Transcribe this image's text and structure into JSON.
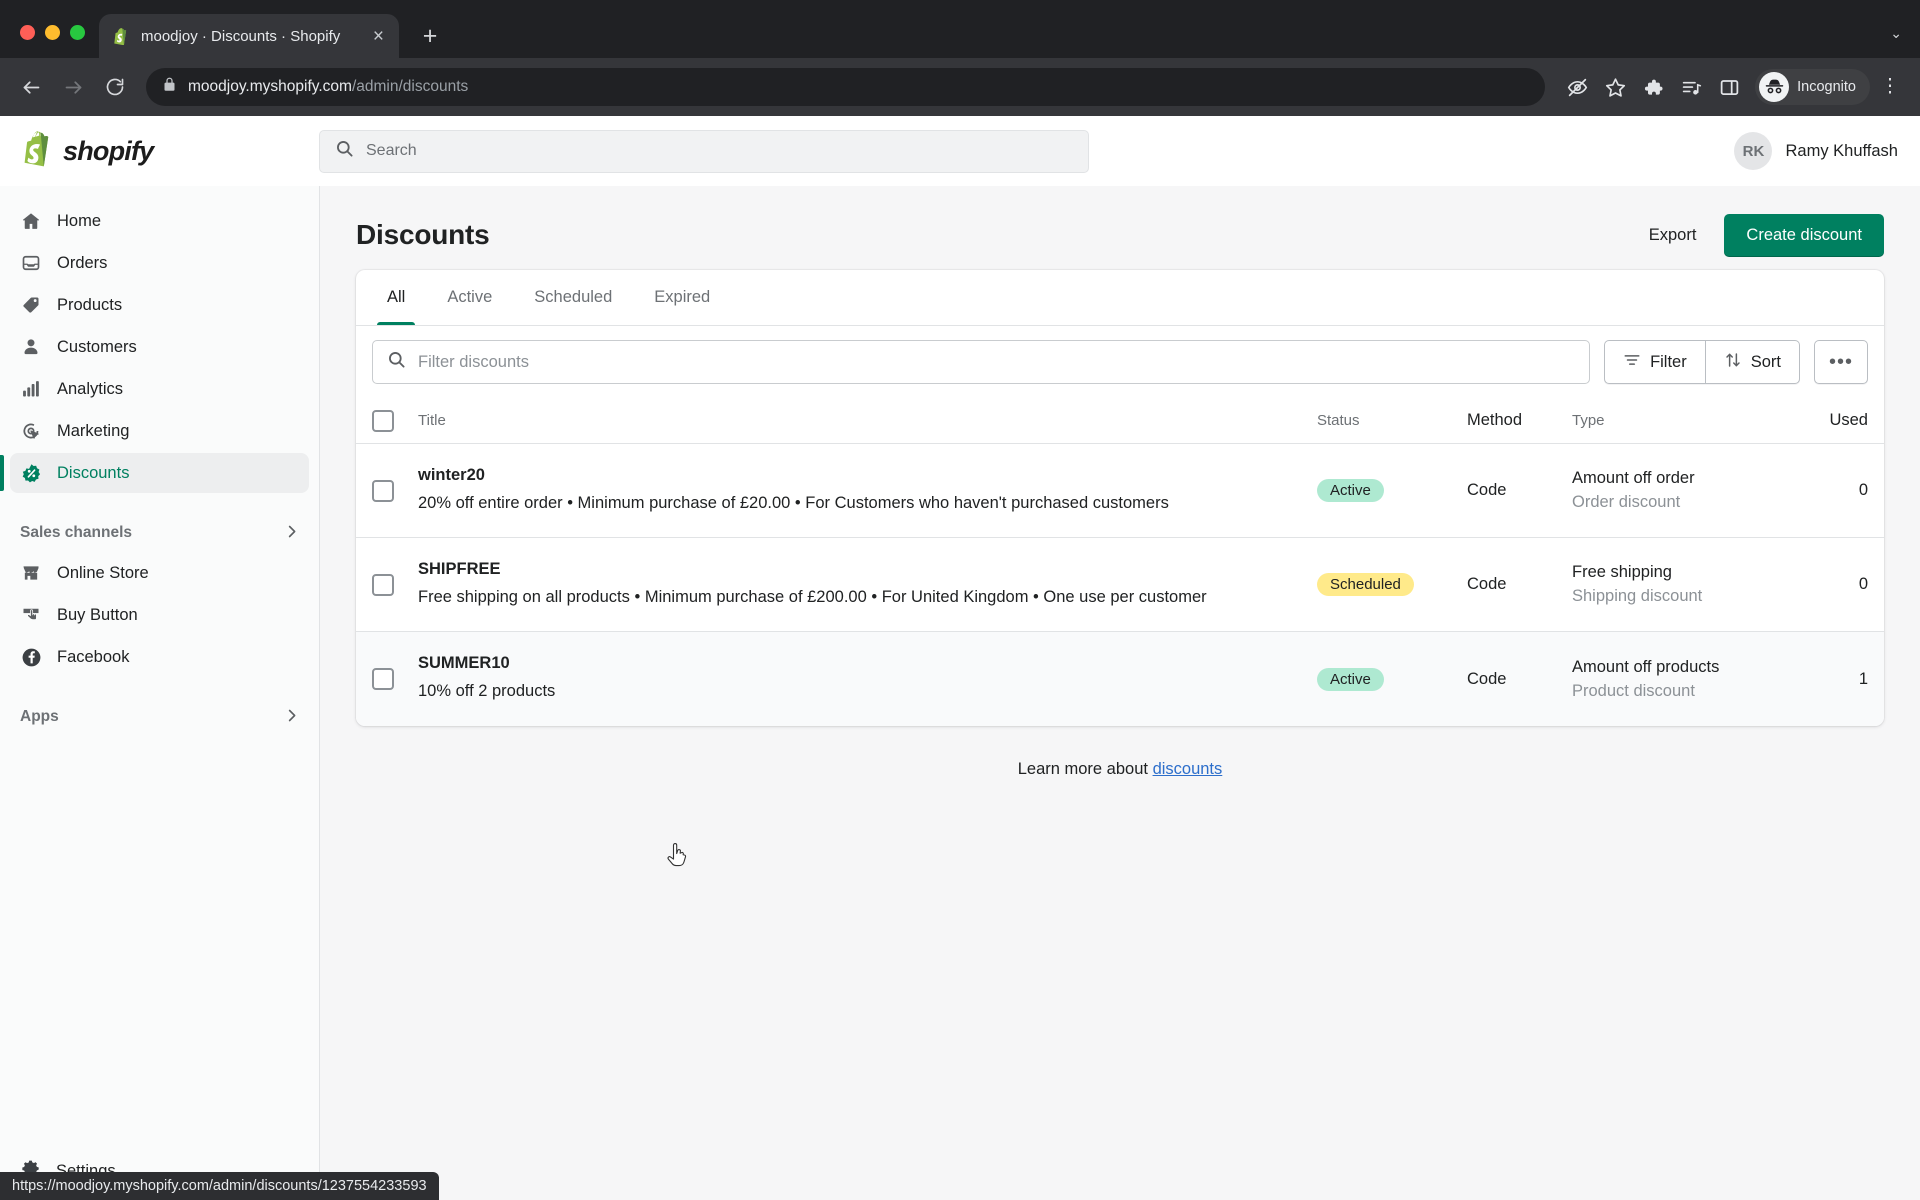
{
  "browser": {
    "tab_title": "moodjoy · Discounts · Shopify",
    "tab_close_label": "×",
    "new_tab_label": "+",
    "url_host": "moodjoy.myshopify.com",
    "url_path": "/admin/discounts",
    "back_label": "←",
    "forward_label": "→",
    "reload_label": "⟳",
    "tab_list_label": "⌄",
    "icons": {
      "eye_off": "eye-off-icon",
      "bookmark": "star-icon",
      "extensions": "puzzle-icon",
      "media": "media-playlist-icon",
      "side_panel": "split-panel-icon",
      "profile": "incognito-avatar-icon",
      "menu": "three-dot-menu-icon"
    },
    "profile_label": "Incognito",
    "kebab_label": "⋮",
    "status_bar_url": "https://moodjoy.myshopify.com/admin/discounts/1237554233593"
  },
  "topbar": {
    "logo_word": "shopify",
    "search_placeholder": "Search",
    "search_value": "",
    "user_initials": "RK",
    "user_name": "Ramy Khuffash"
  },
  "sidebar": {
    "items": [
      {
        "label": "Home",
        "icon": "home-icon"
      },
      {
        "label": "Orders",
        "icon": "orders-inbox-icon"
      },
      {
        "label": "Products",
        "icon": "product-tag-icon"
      },
      {
        "label": "Customers",
        "icon": "customer-person-icon"
      },
      {
        "label": "Analytics",
        "icon": "bar-chart-icon"
      },
      {
        "label": "Marketing",
        "icon": "marketing-target-icon"
      },
      {
        "label": "Discounts",
        "icon": "discount-percent-badge-icon"
      }
    ],
    "active_item": "Discounts",
    "sections": [
      {
        "label": "Sales channels",
        "chevron": "›"
      },
      {
        "label": "Apps",
        "chevron": "›"
      }
    ],
    "channels": [
      {
        "label": "Online Store",
        "icon": "storefront-icon"
      },
      {
        "label": "Buy Button",
        "icon": "buy-button-icon"
      },
      {
        "label": "Facebook",
        "icon": "facebook-icon"
      }
    ],
    "settings": {
      "label": "Settings",
      "icon": "gear-icon"
    }
  },
  "page": {
    "title": "Discounts",
    "export_label": "Export",
    "create_label": "Create discount"
  },
  "tabs": [
    {
      "label": "All",
      "selected": true
    },
    {
      "label": "Active",
      "selected": false
    },
    {
      "label": "Scheduled",
      "selected": false
    },
    {
      "label": "Expired",
      "selected": false
    }
  ],
  "filterbar": {
    "search_placeholder": "Filter discounts",
    "search_value": "",
    "filter_label": "Filter",
    "sort_label": "Sort",
    "more_label": "•••"
  },
  "table": {
    "headers": {
      "title": "Title",
      "status": "Status",
      "method": "Method",
      "type": "Type",
      "used": "Used"
    },
    "rows": [
      {
        "title": "winter20",
        "description": "20% off entire order • Minimum purchase of £20.00 • For Customers who haven't purchased customers",
        "status": "Active",
        "status_tone": "active",
        "method": "Code",
        "type_main": "Amount off order",
        "type_sub": "Order discount",
        "used": "0",
        "hovered": false
      },
      {
        "title": "SHIPFREE",
        "description": "Free shipping on all products • Minimum purchase of £200.00 • For United Kingdom • One use per customer",
        "status": "Scheduled",
        "status_tone": "scheduled",
        "method": "Code",
        "type_main": "Free shipping",
        "type_sub": "Shipping discount",
        "used": "0",
        "hovered": false
      },
      {
        "title": "SUMMER10",
        "description": "10% off 2 products",
        "status": "Active",
        "status_tone": "active",
        "method": "Code",
        "type_main": "Amount off products",
        "type_sub": "Product discount",
        "used": "1",
        "hovered": true
      }
    ]
  },
  "footer": {
    "learn_prefix": "Learn more about ",
    "learn_link": "discounts"
  },
  "colors": {
    "brand_green": "#008060",
    "badge_active": "#aee9d1",
    "badge_scheduled": "#ffea8a",
    "link_blue": "#2c6ecb"
  }
}
